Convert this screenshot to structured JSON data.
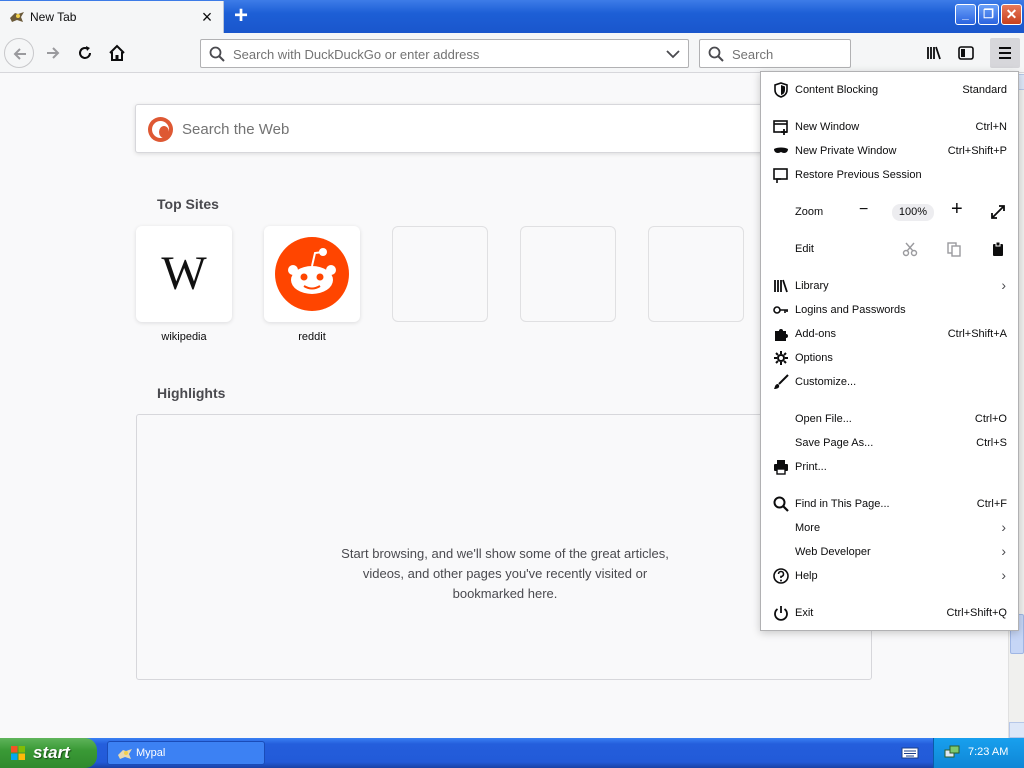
{
  "tab": {
    "title": "New Tab"
  },
  "window_controls": {
    "minimize": "_",
    "maximize": "❐",
    "close": "✕"
  },
  "toolbar": {
    "url_placeholder": "Search with DuckDuckGo or enter address",
    "search_placeholder": "Search"
  },
  "newtab": {
    "web_search_placeholder": "Search the Web",
    "top_sites_title": "Top Sites",
    "top_sites": [
      {
        "label": "wikipedia",
        "icon": "wikipedia-icon"
      },
      {
        "label": "reddit",
        "icon": "reddit-icon"
      }
    ],
    "highlights_title": "Highlights",
    "highlights_message_lines": [
      "Start browsing, and we'll show some of the great articles,",
      "videos, and other pages you've recently visited or",
      "bookmarked here."
    ]
  },
  "app_menu": {
    "content_blocking": {
      "label": "Content Blocking",
      "value": "Standard"
    },
    "new_window": {
      "label": "New Window",
      "shortcut": "Ctrl+N"
    },
    "new_private_window": {
      "label": "New Private Window",
      "shortcut": "Ctrl+Shift+P"
    },
    "restore_session": {
      "label": "Restore Previous Session"
    },
    "zoom": {
      "label": "Zoom",
      "minus": "−",
      "value": "100%",
      "plus": "+"
    },
    "edit": {
      "label": "Edit"
    },
    "library": {
      "label": "Library"
    },
    "logins": {
      "label": "Logins and Passwords"
    },
    "addons": {
      "label": "Add-ons",
      "shortcut": "Ctrl+Shift+A"
    },
    "options": {
      "label": "Options"
    },
    "customize": {
      "label": "Customize..."
    },
    "open_file": {
      "label": "Open File...",
      "shortcut": "Ctrl+O"
    },
    "save_page": {
      "label": "Save Page As...",
      "shortcut": "Ctrl+S"
    },
    "print": {
      "label": "Print..."
    },
    "find": {
      "label": "Find in This Page...",
      "shortcut": "Ctrl+F"
    },
    "more": {
      "label": "More"
    },
    "web_developer": {
      "label": "Web Developer"
    },
    "help": {
      "label": "Help"
    },
    "exit": {
      "label": "Exit",
      "shortcut": "Ctrl+Shift+Q"
    }
  },
  "taskbar": {
    "start_label": "start",
    "task_label": "Mypal",
    "clock": "7:23 AM"
  },
  "colors": {
    "tabbar_blue": "#1d5fd6",
    "menu_bg": "#ffffff",
    "duckduckgo_orange": "#de5833",
    "reddit_orange": "#ff4500",
    "start_green": "#3a9a36"
  }
}
